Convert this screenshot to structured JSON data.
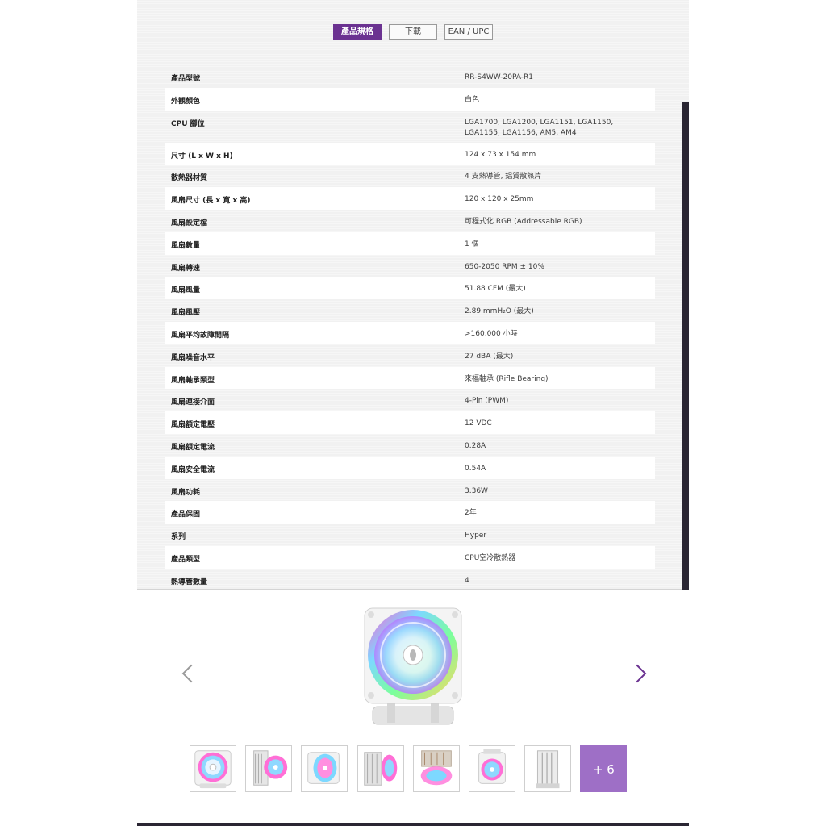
{
  "tabs": [
    {
      "label": "產品規格",
      "active": true
    },
    {
      "label": "下載",
      "active": false
    },
    {
      "label": "EAN / UPC",
      "active": false
    }
  ],
  "specs": [
    {
      "label": "產品型號",
      "value": "RR-S4WW-20PA-R1"
    },
    {
      "label": "外觀顏色",
      "value": "白色"
    },
    {
      "label": "CPU 腳位",
      "value": "LGA1700, LGA1200, LGA1151, LGA1150, LGA1155, LGA1156, AM5, AM4"
    },
    {
      "label": "尺寸 (L x W x H)",
      "value": "124 x 73 x 154 mm"
    },
    {
      "label": "散熱器材質",
      "value": "4 支熱導管, 鋁質散熱片"
    },
    {
      "label": "風扇尺寸 (長 x 寬 x 高)",
      "value": "120 x 120 x 25mm"
    },
    {
      "label": "風扇設定檔",
      "value": "可程式化 RGB (Addressable RGB)"
    },
    {
      "label": "風扇數量",
      "value": "1 個"
    },
    {
      "label": "風扇轉速",
      "value": "650-2050 RPM ± 10%"
    },
    {
      "label": "風扇風量",
      "value": "51.88 CFM (最大)"
    },
    {
      "label": "風扇風壓",
      "value": "2.89 mmH₂O (最大)"
    },
    {
      "label": "風扇平均故障間隔",
      "value": ">160,000 小時"
    },
    {
      "label": "風扇噪音水平",
      "value": "27 dBA (最大)"
    },
    {
      "label": "風扇軸承類型",
      "value": "來福軸承 (Rifle Bearing)"
    },
    {
      "label": "風扇連接介面",
      "value": "4-Pin (PWM)"
    },
    {
      "label": "風扇額定電壓",
      "value": "12 VDC"
    },
    {
      "label": "風扇額定電流",
      "value": "0.28A"
    },
    {
      "label": "風扇安全電流",
      "value": "0.54A"
    },
    {
      "label": "風扇功耗",
      "value": "3.36W"
    },
    {
      "label": "產品保固",
      "value": "2年"
    },
    {
      "label": "系列",
      "value": "Hyper"
    },
    {
      "label": "產品類型",
      "value": "CPU空冷散熱器"
    },
    {
      "label": "熱導管數量",
      "value": "4"
    }
  ],
  "gallery": {
    "thumbnails": [
      "fan-front",
      "heatsink-side",
      "fan-angle",
      "heatsink-fan-side",
      "fan-top-angle",
      "fan-bracket",
      "heatsink-profile"
    ],
    "more_label": "+ 6"
  },
  "colors": {
    "accent": "#6b3291",
    "more_tile": "#9e6fc6",
    "panel_bg": "#f1f1f1"
  }
}
